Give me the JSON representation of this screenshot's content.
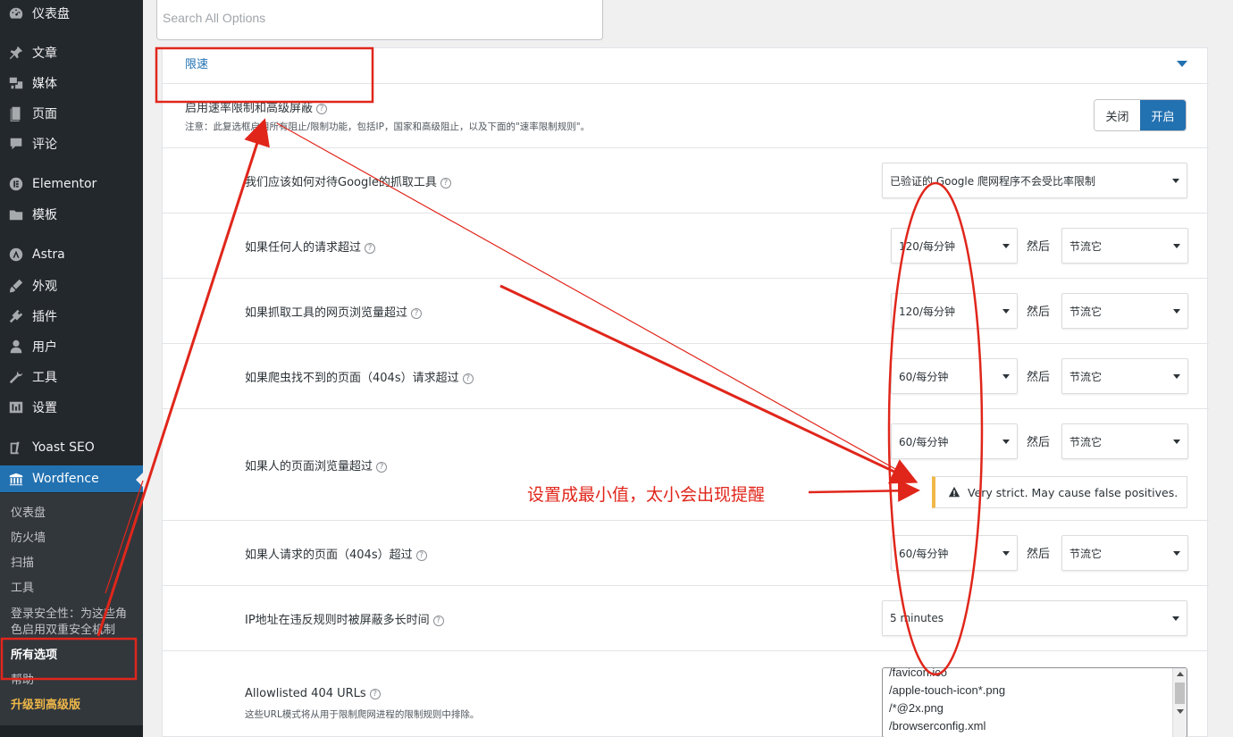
{
  "sidebar": {
    "items": [
      {
        "label": "仪表盘",
        "icon": "dashboard-icon"
      },
      {
        "label": "文章",
        "icon": "pin-icon"
      },
      {
        "label": "媒体",
        "icon": "media-icon"
      },
      {
        "label": "页面",
        "icon": "page-icon"
      },
      {
        "label": "评论",
        "icon": "comment-icon"
      },
      {
        "label": "Elementor",
        "icon": "elementor-icon"
      },
      {
        "label": "模板",
        "icon": "folder-icon"
      },
      {
        "label": "Astra",
        "icon": "astra-icon"
      },
      {
        "label": "外观",
        "icon": "brush-icon"
      },
      {
        "label": "插件",
        "icon": "plugin-icon"
      },
      {
        "label": "用户",
        "icon": "user-icon"
      },
      {
        "label": "工具",
        "icon": "wrench-icon"
      },
      {
        "label": "设置",
        "icon": "settings-icon"
      },
      {
        "label": "Yoast SEO",
        "icon": "yoast-icon"
      },
      {
        "label": "Wordfence",
        "icon": "wordfence-icon"
      }
    ],
    "submenu": [
      "仪表盘",
      "防火墙",
      "扫描",
      "工具",
      "登录安全性：为这些角",
      "色启用双重安全机制",
      "所有选项",
      "帮助",
      "升级到高级版"
    ]
  },
  "search": {
    "placeholder": "Search All Options"
  },
  "section": {
    "title": "限速"
  },
  "master": {
    "label": "启用速率限制和高级屏蔽",
    "note": "注意：此复选框启用所有阻止/限制功能，包括IP，国家和高级阻止，以及下面的\"速率限制规则\"。",
    "off_label": "关闭",
    "on_label": "开启"
  },
  "options": {
    "google": {
      "label": "我们应该如何对待Google的抓取工具",
      "value": "已验证的 Google 爬网程序不会受比率限制"
    },
    "anyone": {
      "label": "如果任何人的请求超过",
      "rate": "120/每分钟",
      "then": "然后",
      "action": "节流它"
    },
    "crawler_views": {
      "label": "如果抓取工具的网页浏览量超过",
      "rate": "120/每分钟",
      "then": "然后",
      "action": "节流它"
    },
    "crawler_404": {
      "label": "如果爬虫找不到的页面（404s）请求超过",
      "rate": "60/每分钟",
      "then": "然后",
      "action": "节流它"
    },
    "human_views": {
      "label": "如果人的页面浏览量超过",
      "rate": "60/每分钟",
      "then": "然后",
      "action": "节流它",
      "warning": "Very strict. May cause false positives."
    },
    "human_404": {
      "label": "如果人请求的页面（404s）超过",
      "rate": "60/每分钟",
      "then": "然后",
      "action": "节流它"
    },
    "block_time": {
      "label": "IP地址在违反规则时被屏蔽多长时间",
      "value": "5 minutes"
    },
    "allowlist": {
      "label": "Allowlisted 404 URLs",
      "note": "这些URL模式将从用于限制爬网进程的限制规则中排除。",
      "lines": [
        "/favicon.ico",
        "/apple-touch-icon*.png",
        "/*@2x.png",
        "/browserconfig.xml"
      ]
    }
  },
  "annotation": {
    "callout": "设置成最小值，太小会出现提醒"
  },
  "colors": {
    "accent": "#2271b1",
    "annotation": "#e0261b",
    "warning": "#f0b849",
    "sidebar": "#23282d"
  }
}
